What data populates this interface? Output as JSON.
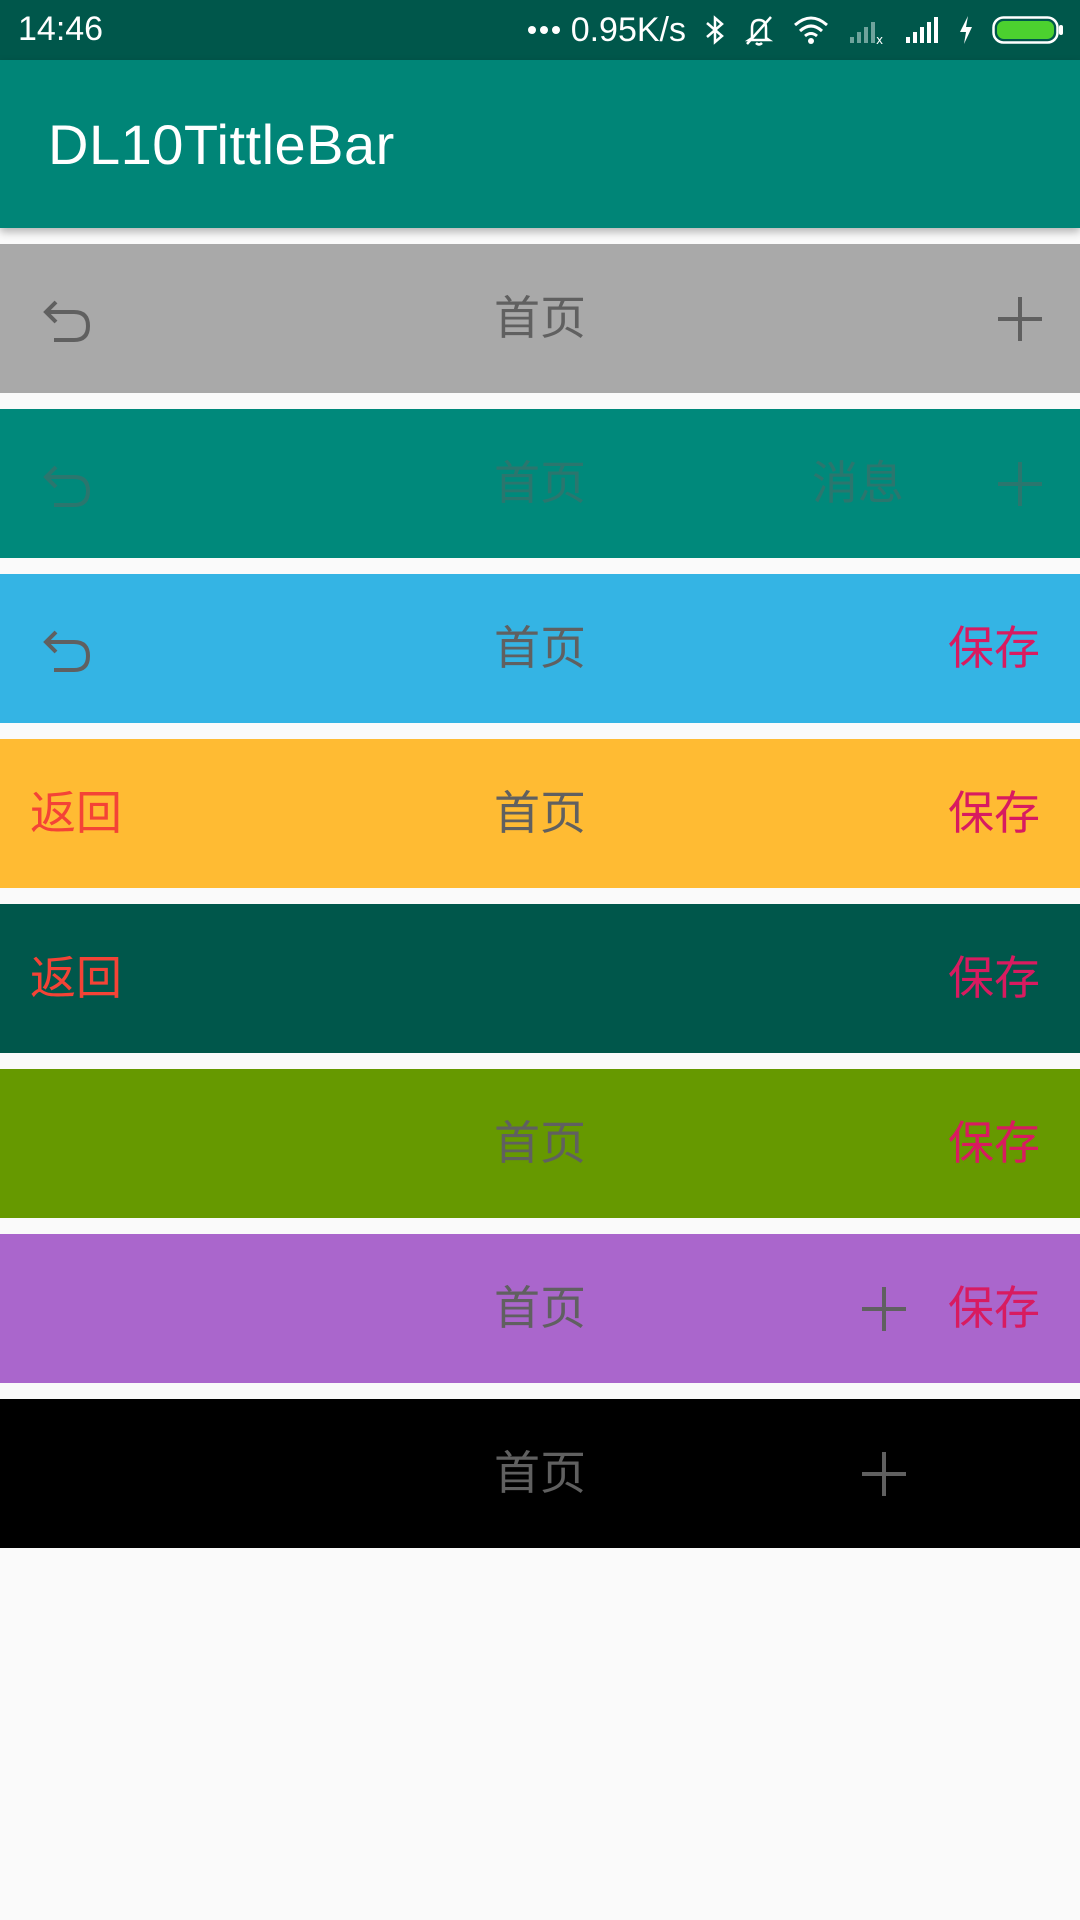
{
  "status_bar": {
    "time": "14:46",
    "net_speed": "0.95K/s",
    "icons": [
      "more-dots-icon",
      "bluetooth-icon",
      "bell-off-icon",
      "wifi-icon",
      "signal-empty-icon",
      "signal-full-icon",
      "charging-icon",
      "battery-icon"
    ]
  },
  "app_bar": {
    "title": "DL10TittleBar"
  },
  "title_bars": [
    {
      "bg": "#a9a9a9",
      "left_icon": "undo-arrow-icon",
      "title": "首页",
      "right_icon": "plus-icon"
    },
    {
      "bg": "#00897b",
      "left_icon": "undo-arrow-icon",
      "title": "首页",
      "right_text": "消息",
      "right_icon": "plus-icon"
    },
    {
      "bg": "#34b4e4",
      "left_icon": "undo-arrow-icon",
      "title": "首页",
      "right_text": "保存"
    },
    {
      "bg": "#ffbb33",
      "left_text": "返回",
      "title": "首页",
      "right_text": "保存"
    },
    {
      "bg": "#00574b",
      "left_text": "返回",
      "right_text": "保存"
    },
    {
      "bg": "#669900",
      "title": "首页",
      "right_text": "保存"
    },
    {
      "bg": "#aa66cc",
      "title": "首页",
      "right_icon": "plus-icon",
      "right_text": "保存"
    },
    {
      "bg": "#000000",
      "title": "首页",
      "right_icon": "plus-icon"
    }
  ],
  "colors": {
    "status_bar": "#00574b",
    "app_bar": "#008577",
    "title_text": "#606060",
    "back_text": "#f44336",
    "save_text": "#d81b60",
    "page_bg": "#fafafa"
  }
}
